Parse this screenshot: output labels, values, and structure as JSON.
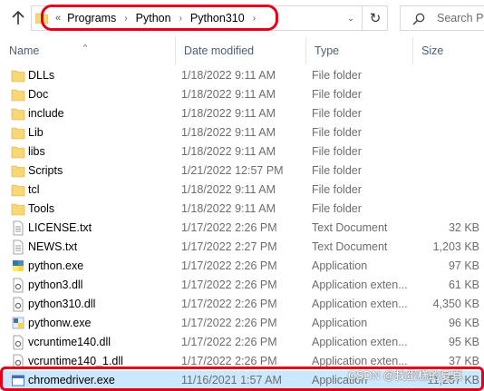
{
  "address_bar": {
    "overflow_glyph": "«",
    "crumbs": [
      "Programs",
      "Python",
      "Python310"
    ],
    "chevron": "›",
    "dropdown_glyph": "⌄",
    "refresh_glyph": "↻"
  },
  "search": {
    "placeholder": "Search Py"
  },
  "columns": {
    "name": "Name",
    "date": "Date modified",
    "type": "Type",
    "size": "Size",
    "sort_indicator": "^"
  },
  "files": [
    {
      "name": "DLLs",
      "date": "1/18/2022 9:11 AM",
      "type": "File folder",
      "size": "",
      "icon": "folder-icon"
    },
    {
      "name": "Doc",
      "date": "1/18/2022 9:11 AM",
      "type": "File folder",
      "size": "",
      "icon": "folder-icon"
    },
    {
      "name": "include",
      "date": "1/18/2022 9:11 AM",
      "type": "File folder",
      "size": "",
      "icon": "folder-icon"
    },
    {
      "name": "Lib",
      "date": "1/18/2022 9:11 AM",
      "type": "File folder",
      "size": "",
      "icon": "folder-icon"
    },
    {
      "name": "libs",
      "date": "1/18/2022 9:11 AM",
      "type": "File folder",
      "size": "",
      "icon": "folder-icon"
    },
    {
      "name": "Scripts",
      "date": "1/21/2022 12:57 PM",
      "type": "File folder",
      "size": "",
      "icon": "folder-icon"
    },
    {
      "name": "tcl",
      "date": "1/18/2022 9:11 AM",
      "type": "File folder",
      "size": "",
      "icon": "folder-icon"
    },
    {
      "name": "Tools",
      "date": "1/18/2022 9:11 AM",
      "type": "File folder",
      "size": "",
      "icon": "folder-icon"
    },
    {
      "name": "LICENSE.txt",
      "date": "1/17/2022 2:26 PM",
      "type": "Text Document",
      "size": "32 KB",
      "icon": "text-file-icon"
    },
    {
      "name": "NEWS.txt",
      "date": "1/17/2022 2:27 PM",
      "type": "Text Document",
      "size": "1,203 KB",
      "icon": "text-file-icon"
    },
    {
      "name": "python.exe",
      "date": "1/17/2022 2:26 PM",
      "type": "Application",
      "size": "97 KB",
      "icon": "python-exe-icon"
    },
    {
      "name": "python3.dll",
      "date": "1/17/2022 2:26 PM",
      "type": "Application exten...",
      "size": "61 KB",
      "icon": "dll-file-icon"
    },
    {
      "name": "python310.dll",
      "date": "1/17/2022 2:26 PM",
      "type": "Application exten...",
      "size": "4,350 KB",
      "icon": "dll-file-icon"
    },
    {
      "name": "pythonw.exe",
      "date": "1/17/2022 2:26 PM",
      "type": "Application",
      "size": "96 KB",
      "icon": "python-exe-icon"
    },
    {
      "name": "vcruntime140.dll",
      "date": "1/17/2022 2:26 PM",
      "type": "Application exten...",
      "size": "95 KB",
      "icon": "dll-file-icon"
    },
    {
      "name": "vcruntime140_1.dll",
      "date": "1/17/2022 2:26 PM",
      "type": "Application exten...",
      "size": "37 KB",
      "icon": "dll-file-icon"
    },
    {
      "name": "chromedriver.exe",
      "date": "11/16/2021 1:57 AM",
      "type": "Application",
      "size": "11,257 KB",
      "icon": "app-exe-icon",
      "selected": true
    }
  ],
  "watermark": "CSDN @找蛋糕的夏真",
  "colors": {
    "annotation_red": "#e2001a",
    "selection": "#cce8ff",
    "folder": "#f8d775"
  }
}
